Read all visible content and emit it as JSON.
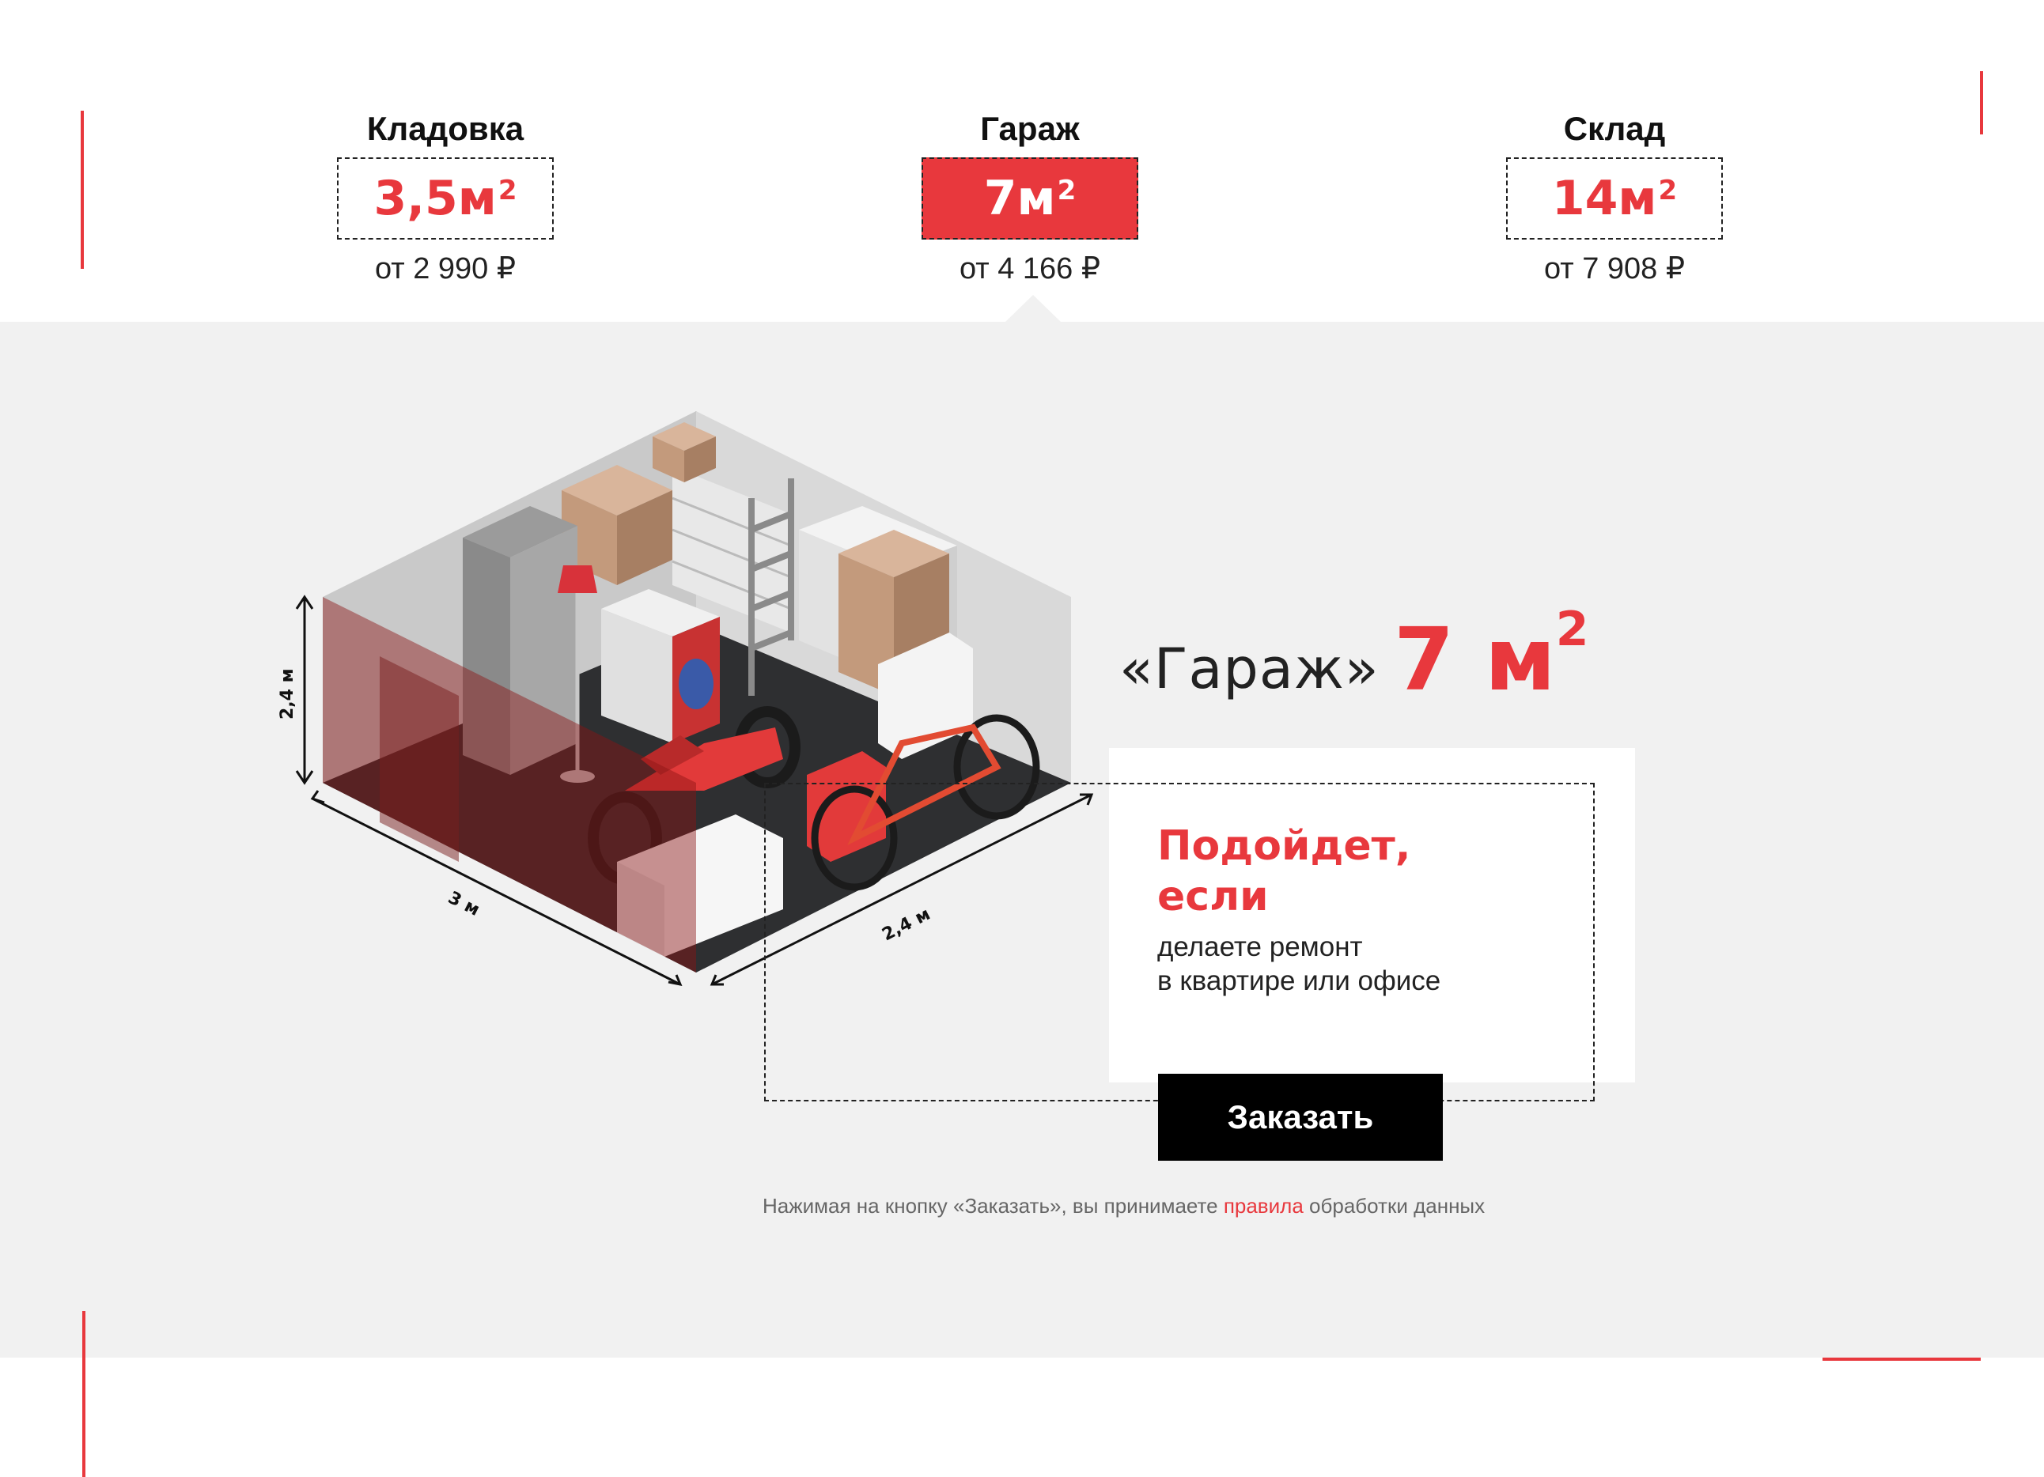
{
  "tabs": [
    {
      "title": "Кладовка",
      "area": "3,5м",
      "sup": "2",
      "price": "от 2 990 ₽"
    },
    {
      "title": "Гараж",
      "area": "7м",
      "sup": "2",
      "price": "от 4 166 ₽"
    },
    {
      "title": "Склад",
      "area": "14м",
      "sup": "2",
      "price": "от 7 908 ₽"
    }
  ],
  "selected_tab": "Гараж",
  "room": {
    "title": "«Гараж»",
    "area": "7 м",
    "area_sup": "2",
    "dims": {
      "height": "2,4 м",
      "length": "3 м",
      "width": "2,4 м"
    }
  },
  "card": {
    "title_line1": "Подойдет,",
    "title_line2": "если",
    "text_line1": "делаете ремонт",
    "text_line2": "в квартире или офисе"
  },
  "order_button": "Заказать",
  "consent": {
    "before": "Нажимая на кнопку «Заказать», вы принимаете ",
    "link": "правила",
    "after": " обработки данных"
  },
  "colors": {
    "accent": "#e8383d",
    "band": "#f1f1f1",
    "button": "#000000"
  }
}
